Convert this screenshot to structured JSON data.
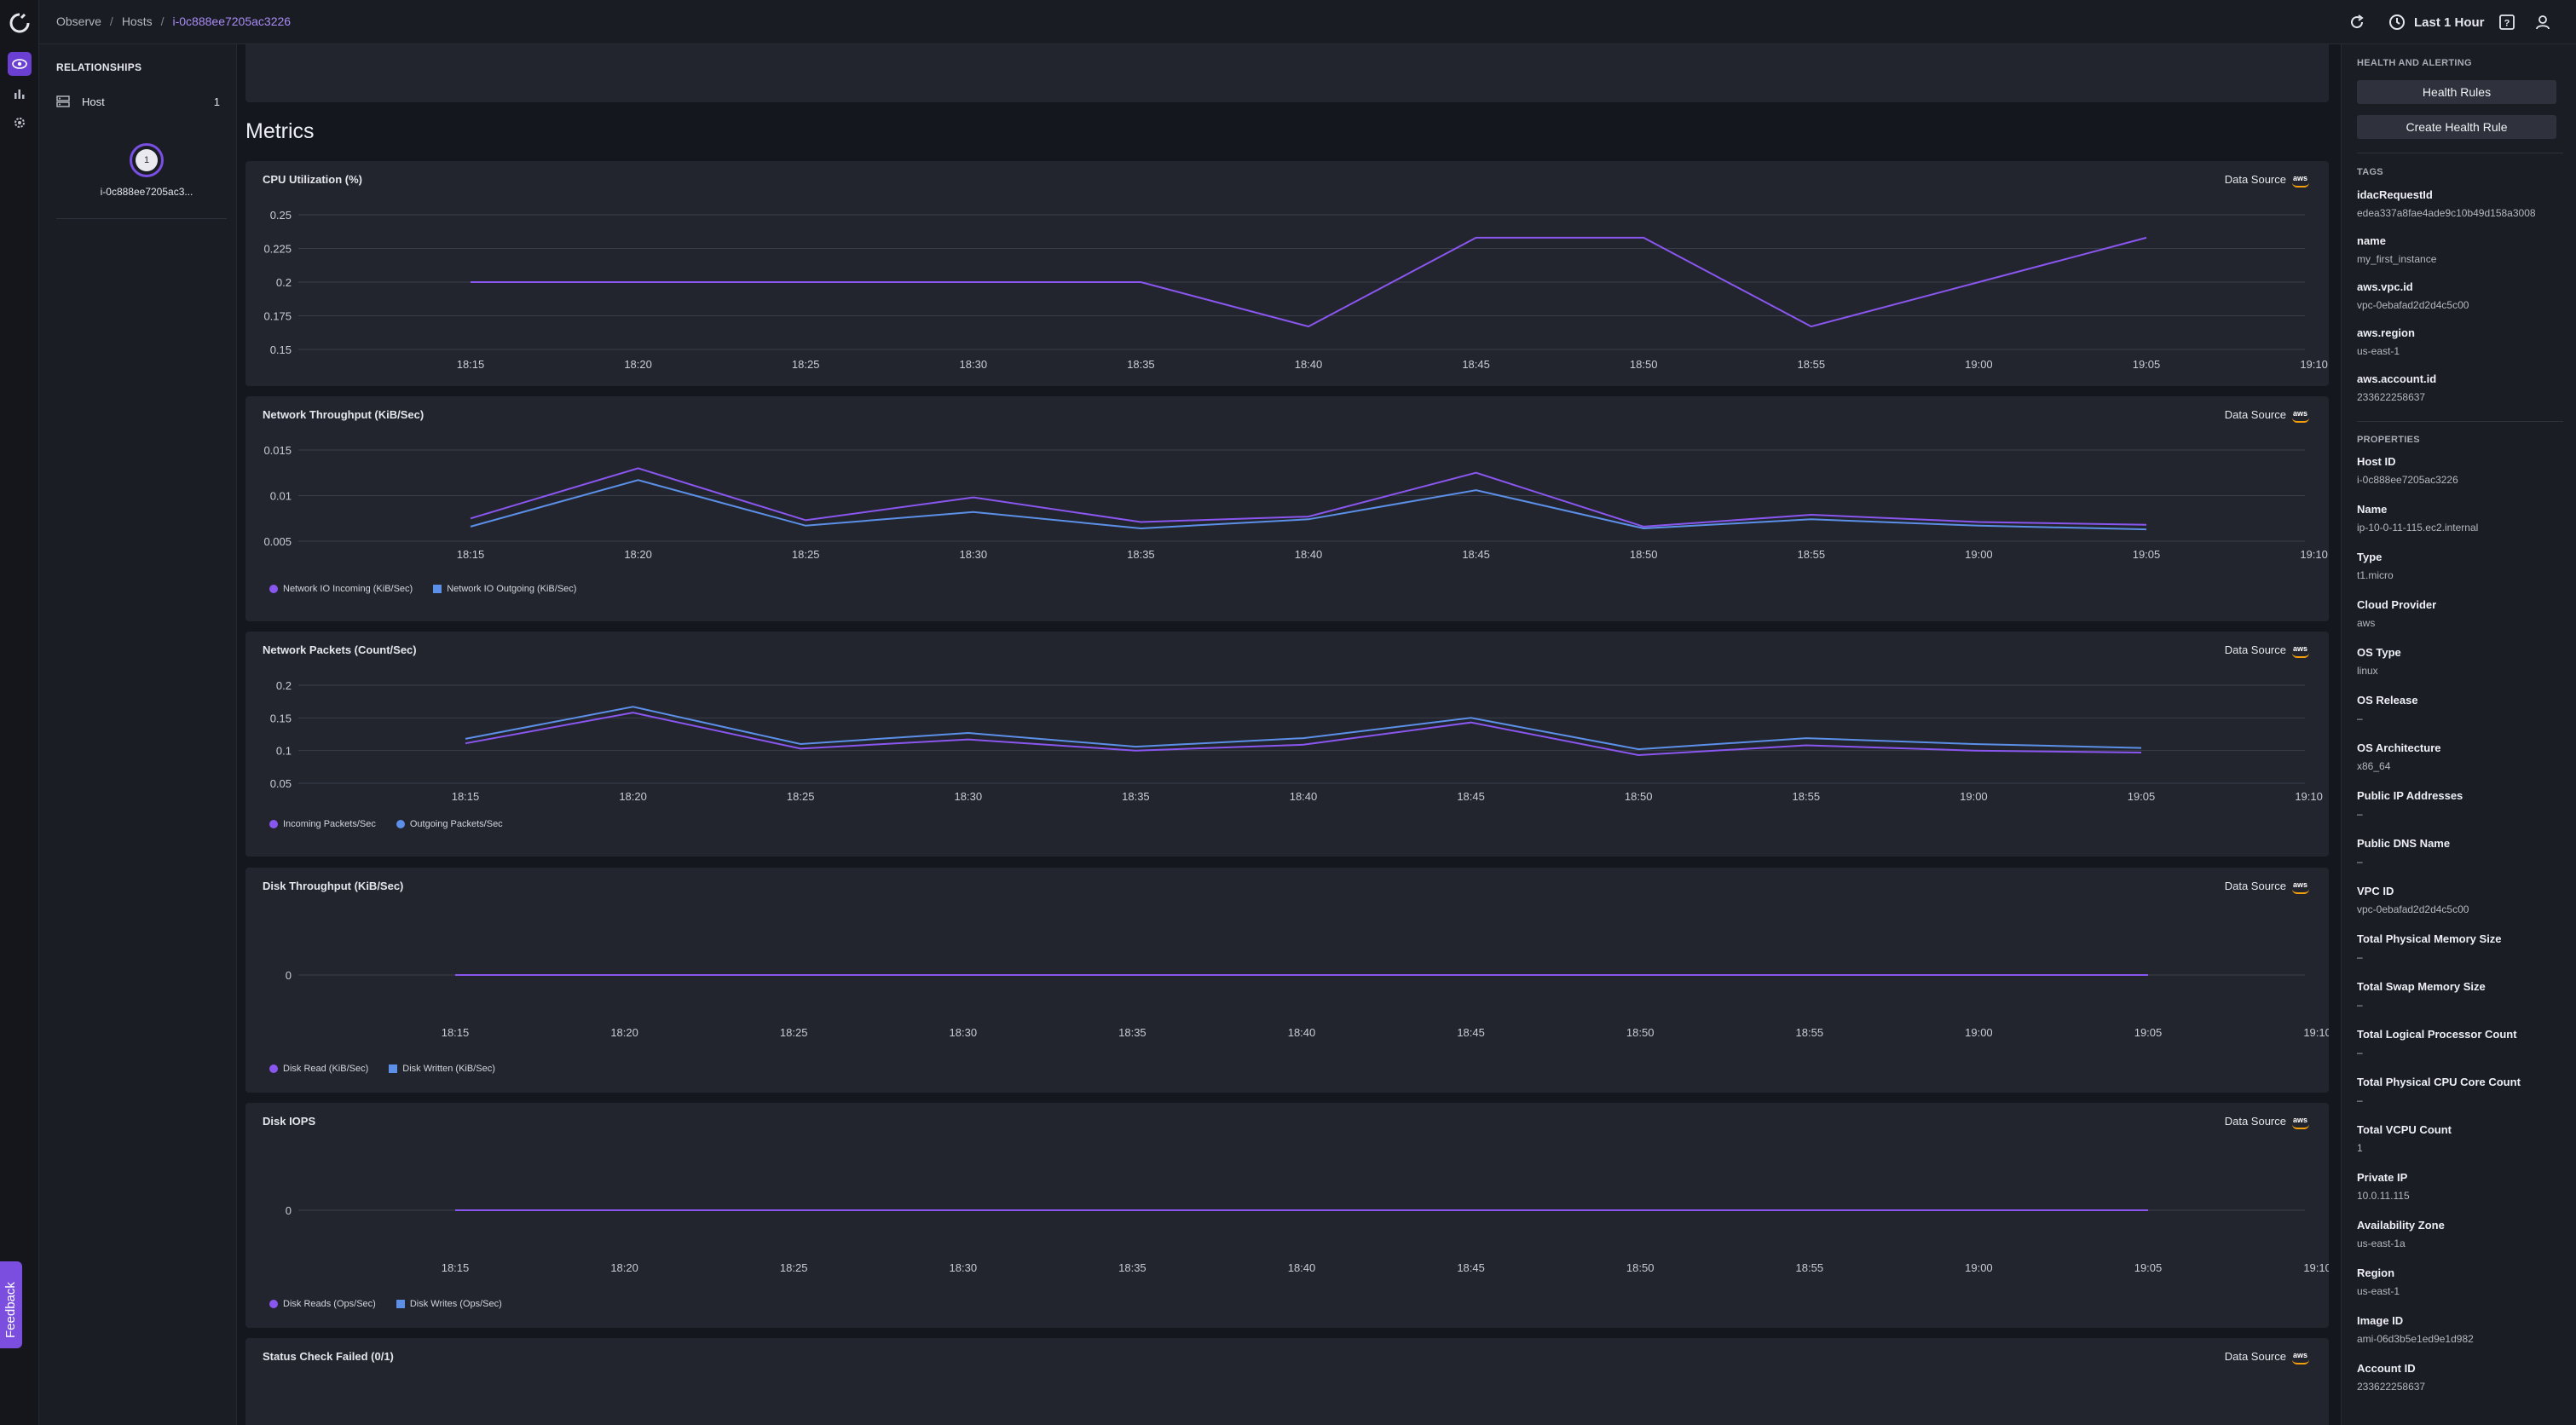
{
  "breadcrumb": {
    "items": [
      "Observe",
      "Hosts"
    ],
    "current": "i-0c888ee7205ac3226",
    "separator": "/"
  },
  "topbar": {
    "time_range": "Last 1 Hour"
  },
  "rail": {
    "icons": [
      "observe-eye-icon",
      "bar-chart-icon",
      "settings-gear-icon"
    ],
    "feedback_label": "Feedback"
  },
  "relationships": {
    "title": "RELATIONSHIPS",
    "row": {
      "label": "Host",
      "count": "1"
    },
    "node": {
      "count": "1",
      "label": "i-0c888ee7205ac3..."
    }
  },
  "main": {
    "title": "Metrics",
    "data_source_label": "Data Source",
    "aws_label": "aws"
  },
  "chart_data": [
    {
      "type": "line",
      "title": "CPU Utilization (%)",
      "x": [
        "18:15",
        "18:20",
        "18:25",
        "18:30",
        "18:35",
        "18:40",
        "18:45",
        "18:50",
        "18:55",
        "19:00",
        "19:05",
        "19:10"
      ],
      "y_ticks": [
        "0.25",
        "0.225",
        "0.2",
        "0.175",
        "0.15"
      ],
      "ylim": [
        0.15,
        0.25
      ],
      "series": [
        {
          "color": "#8a56f0",
          "values": [
            0.2,
            0.2,
            0.2,
            0.2,
            0.2,
            0.167,
            0.233,
            0.233,
            0.167,
            0.2,
            0.233,
            null
          ]
        }
      ],
      "legend": []
    },
    {
      "type": "line",
      "title": "Network Throughput (KiB/Sec)",
      "x": [
        "18:15",
        "18:20",
        "18:25",
        "18:30",
        "18:35",
        "18:40",
        "18:45",
        "18:50",
        "18:55",
        "19:00",
        "19:05",
        "19:10"
      ],
      "y_ticks": [
        "0.015",
        "0.01",
        "0.005"
      ],
      "ylim": [
        0.005,
        0.015
      ],
      "series": [
        {
          "name": "Network IO Incoming (KiB/Sec)",
          "color": "#8a56f0",
          "marker": "dot",
          "values": [
            0.0075,
            0.013,
            0.0073,
            0.0098,
            0.0071,
            0.0077,
            0.0125,
            0.0066,
            0.0079,
            0.0071,
            0.0068,
            null
          ]
        },
        {
          "name": "Network IO Outgoing (KiB/Sec)",
          "color": "#5b8fe8",
          "marker": "square",
          "values": [
            0.0066,
            0.0117,
            0.0067,
            0.0082,
            0.0064,
            0.0074,
            0.0106,
            0.0064,
            0.0074,
            0.0067,
            0.0063,
            null
          ]
        }
      ]
    },
    {
      "type": "line",
      "title": "Network Packets (Count/Sec)",
      "x": [
        "18:15",
        "18:20",
        "18:25",
        "18:30",
        "18:35",
        "18:40",
        "18:45",
        "18:50",
        "18:55",
        "19:00",
        "19:05",
        "19:10"
      ],
      "y_ticks": [
        "0.2",
        "0.15",
        "0.1",
        "0.05"
      ],
      "ylim": [
        0.05,
        0.2
      ],
      "series": [
        {
          "name": "Incoming Packets/Sec",
          "color": "#8a56f0",
          "marker": "dot",
          "values": [
            0.111,
            0.158,
            0.103,
            0.117,
            0.1,
            0.109,
            0.143,
            0.093,
            0.108,
            0.1,
            0.097,
            null
          ]
        },
        {
          "name": "Outgoing Packets/Sec",
          "color": "#5b8fe8",
          "marker": "dot",
          "values": [
            0.118,
            0.167,
            0.11,
            0.127,
            0.106,
            0.119,
            0.15,
            0.102,
            0.119,
            0.11,
            0.104,
            null
          ]
        }
      ]
    },
    {
      "type": "line",
      "title": "Disk Throughput (KiB/Sec)",
      "x": [
        "18:15",
        "18:20",
        "18:25",
        "18:30",
        "18:35",
        "18:40",
        "18:45",
        "18:50",
        "18:55",
        "19:00",
        "19:05",
        "19:10"
      ],
      "y_ticks": [
        "0"
      ],
      "ylim": [
        -1,
        1
      ],
      "series": [
        {
          "name": "Disk Read (KiB/Sec)",
          "color": "#8a56f0",
          "marker": "dot",
          "values": [
            0,
            0,
            0,
            0,
            0,
            0,
            0,
            0,
            0,
            0,
            0,
            null
          ]
        },
        {
          "name": "Disk Written (KiB/Sec)",
          "color": "#5b8fe8",
          "marker": "square",
          "values": [
            0,
            0,
            0,
            0,
            0,
            0,
            0,
            0,
            0,
            0,
            0,
            null
          ]
        }
      ]
    },
    {
      "type": "line",
      "title": "Disk IOPS",
      "x": [
        "18:15",
        "18:20",
        "18:25",
        "18:30",
        "18:35",
        "18:40",
        "18:45",
        "18:50",
        "18:55",
        "19:00",
        "19:05",
        "19:10"
      ],
      "y_ticks": [
        "0"
      ],
      "ylim": [
        -1,
        1
      ],
      "series": [
        {
          "name": "Disk Reads (Ops/Sec)",
          "color": "#8a56f0",
          "marker": "dot",
          "values": [
            0,
            0,
            0,
            0,
            0,
            0,
            0,
            0,
            0,
            0,
            0,
            null
          ]
        },
        {
          "name": "Disk Writes (Ops/Sec)",
          "color": "#5b8fe8",
          "marker": "square",
          "values": [
            0,
            0,
            0,
            0,
            0,
            0,
            0,
            0,
            0,
            0,
            0,
            null
          ]
        }
      ]
    },
    {
      "type": "line",
      "title": "Status Check Failed (0/1)",
      "x": [],
      "series": []
    }
  ],
  "right_panel": {
    "health_title": "HEALTH AND ALERTING",
    "health_rules": "Health Rules",
    "create_health_rule": "Create Health Rule",
    "tags_title": "TAGS",
    "tags": [
      {
        "key": "idacRequestId",
        "value": "edea337a8fae4ade9c10b49d158a3008"
      },
      {
        "key": "name",
        "value": "my_first_instance"
      },
      {
        "key": "aws.vpc.id",
        "value": "vpc-0ebafad2d2d4c5c00"
      },
      {
        "key": "aws.region",
        "value": "us-east-1"
      },
      {
        "key": "aws.account.id",
        "value": "233622258637"
      }
    ],
    "properties_title": "PROPERTIES",
    "properties": [
      {
        "key": "Host ID",
        "value": "i-0c888ee7205ac3226"
      },
      {
        "key": "Name",
        "value": "ip-10-0-11-115.ec2.internal"
      },
      {
        "key": "Type",
        "value": "t1.micro"
      },
      {
        "key": "Cloud Provider",
        "value": "aws"
      },
      {
        "key": "OS Type",
        "value": "linux"
      },
      {
        "key": "OS Release",
        "value": "–"
      },
      {
        "key": "OS Architecture",
        "value": "x86_64"
      },
      {
        "key": "Public IP Addresses",
        "value": "–"
      },
      {
        "key": "Public DNS Name",
        "value": "–"
      },
      {
        "key": "VPC ID",
        "value": "vpc-0ebafad2d2d4c5c00"
      },
      {
        "key": "Total Physical Memory Size",
        "value": "–"
      },
      {
        "key": "Total Swap Memory Size",
        "value": "–"
      },
      {
        "key": "Total Logical Processor Count",
        "value": "–"
      },
      {
        "key": "Total Physical CPU Core Count",
        "value": "–"
      },
      {
        "key": "Total VCPU Count",
        "value": "1"
      },
      {
        "key": "Private IP",
        "value": "10.0.11.115"
      },
      {
        "key": "Availability Zone",
        "value": "us-east-1a"
      },
      {
        "key": "Region",
        "value": "us-east-1"
      },
      {
        "key": "Image ID",
        "value": "ami-06d3b5e1ed9e1d982"
      },
      {
        "key": "Account ID",
        "value": "233622258637"
      }
    ]
  }
}
